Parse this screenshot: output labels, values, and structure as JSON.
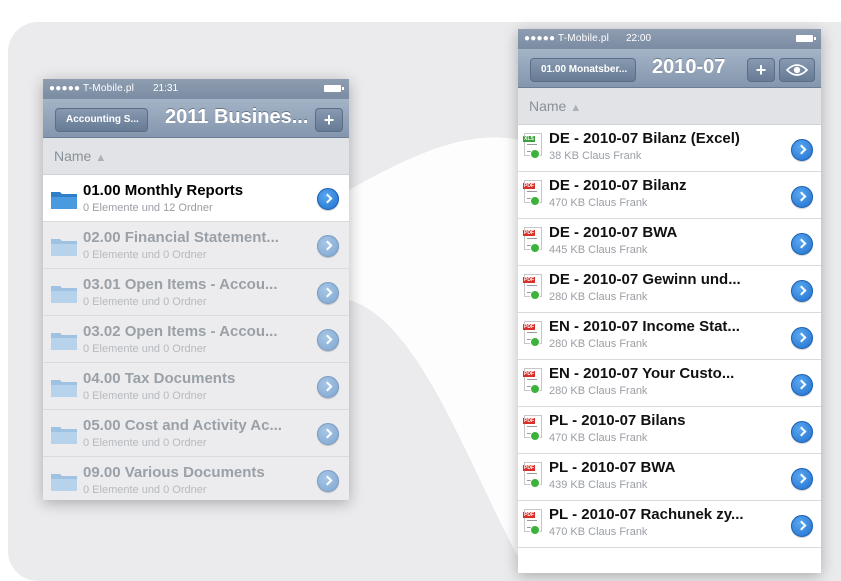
{
  "left_phone": {
    "status": {
      "carrier": "●●●●● T-Mobile.pl",
      "time": "21:31"
    },
    "nav": {
      "back": "Accounting S...",
      "title": "2011 Busines...",
      "add": "+"
    },
    "sort_label": "Name",
    "rows": [
      {
        "title": "01.00 Monthly Reports",
        "sub": "0 Elemente und 12 Ordner",
        "active": true
      },
      {
        "title": "02.00 Financial Statement...",
        "sub": "0 Elemente und 0 Ordner",
        "active": false
      },
      {
        "title": "03.01 Open Items - Accou...",
        "sub": "0 Elemente und 0 Ordner",
        "active": false
      },
      {
        "title": "03.02 Open Items - Accou...",
        "sub": "0 Elemente und 0 Ordner",
        "active": false
      },
      {
        "title": "04.00 Tax Documents",
        "sub": "0 Elemente und 0 Ordner",
        "active": false
      },
      {
        "title": "05.00 Cost and Activity Ac...",
        "sub": "0 Elemente und 0 Ordner",
        "active": false
      },
      {
        "title": "09.00 Various Documents",
        "sub": "0 Elemente und 0 Ordner",
        "active": false
      }
    ]
  },
  "right_phone": {
    "status": {
      "carrier": "●●●●● T-Mobile.pl",
      "time": "22:00"
    },
    "nav": {
      "back": "01.00 Monatsber...",
      "title": "2010-07",
      "add": "+"
    },
    "sort_label": "Name",
    "rows": [
      {
        "title": "DE - 2010-07 Bilanz (Excel)",
        "sub": "38 KB  Claus Frank",
        "type": "XLS"
      },
      {
        "title": "DE - 2010-07 Bilanz",
        "sub": "470 KB  Claus Frank",
        "type": "PDF"
      },
      {
        "title": "DE - 2010-07 BWA",
        "sub": "445 KB  Claus Frank",
        "type": "PDF"
      },
      {
        "title": "DE - 2010-07 Gewinn und...",
        "sub": "280 KB  Claus Frank",
        "type": "PDF"
      },
      {
        "title": "EN - 2010-07 Income Stat...",
        "sub": "280 KB  Claus Frank",
        "type": "PDF"
      },
      {
        "title": "EN - 2010-07 Your Custo...",
        "sub": "280 KB  Claus Frank",
        "type": "PDF"
      },
      {
        "title": "PL - 2010-07 Bilans",
        "sub": "470 KB  Claus Frank",
        "type": "PDF"
      },
      {
        "title": "PL - 2010-07 BWA",
        "sub": "439 KB  Claus Frank",
        "type": "PDF"
      },
      {
        "title": "PL - 2010-07 Rachunek zy...",
        "sub": "470 KB  Claus Frank",
        "type": "PDF"
      }
    ]
  },
  "colors": {
    "disclosure": "#1f6fce",
    "navbar": "#8e9fb5",
    "pdf_tag": "#d9302a",
    "xls_tag": "#3aa13a",
    "sync_dot": "#3bb33b"
  },
  "icons": {
    "folder": "folder-icon",
    "pdf": "pdf-file-icon",
    "xls": "excel-file-icon",
    "disclosure": "disclosure-arrow-icon",
    "eye": "eye-icon",
    "battery": "battery-icon",
    "wifi": "wifi-icon"
  }
}
